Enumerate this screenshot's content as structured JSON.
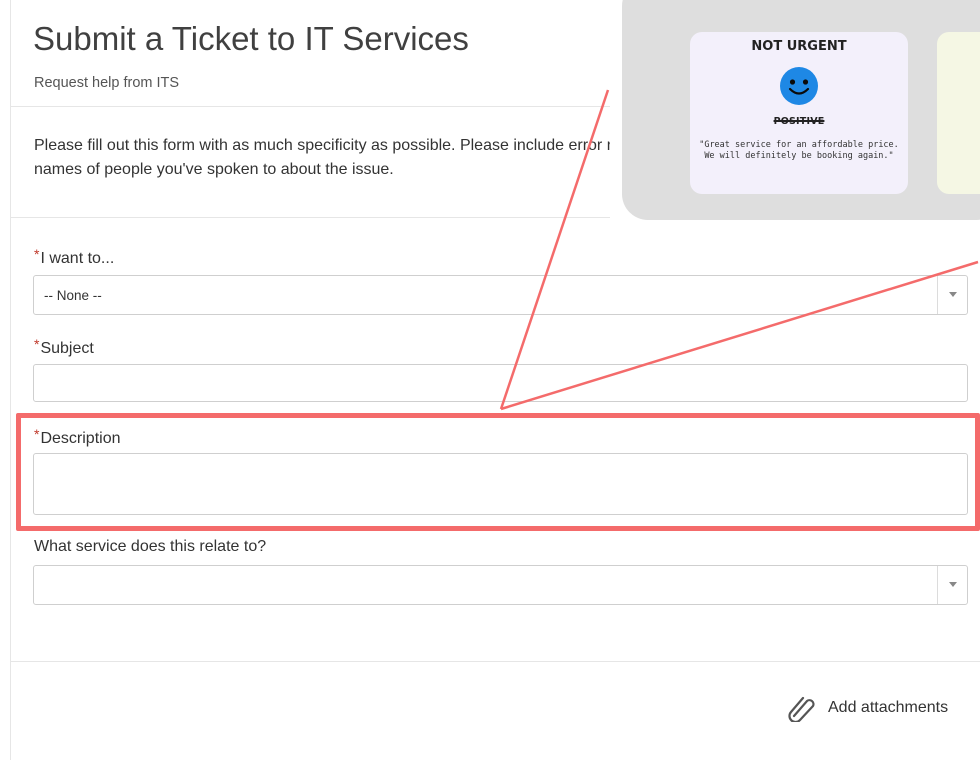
{
  "form": {
    "title": "Submit a Ticket to IT Services",
    "subtitle": "Request help from ITS",
    "intro": "Please fill out this form with as much specificity as possible. Please include error messages you've received, what you've tried, or the names of people you've spoken to about the issue.",
    "required_marker": "*",
    "fields": {
      "i_want_to": {
        "label": "I want to...",
        "value": "-- None --"
      },
      "subject": {
        "label": "Subject",
        "value": ""
      },
      "description": {
        "label": "Description",
        "value": ""
      },
      "service": {
        "label": "What service does this relate to?",
        "value": ""
      }
    },
    "attach_label": "Add attachments"
  },
  "overlay": {
    "card_title": "NOT URGENT",
    "sentiment": "POSITIVE",
    "quote": "\"Great service for an affordable price.\nWe will definitely be booking again.\"",
    "icons": [
      "smiley-face-icon"
    ]
  },
  "colors": {
    "highlight": "#f46b6b",
    "required": "#c0392b",
    "smiley": "#1e88e5",
    "overlay_bg": "#dedede",
    "tile_purple": "#f3f0fb",
    "tile_green": "#f5f7e4"
  }
}
